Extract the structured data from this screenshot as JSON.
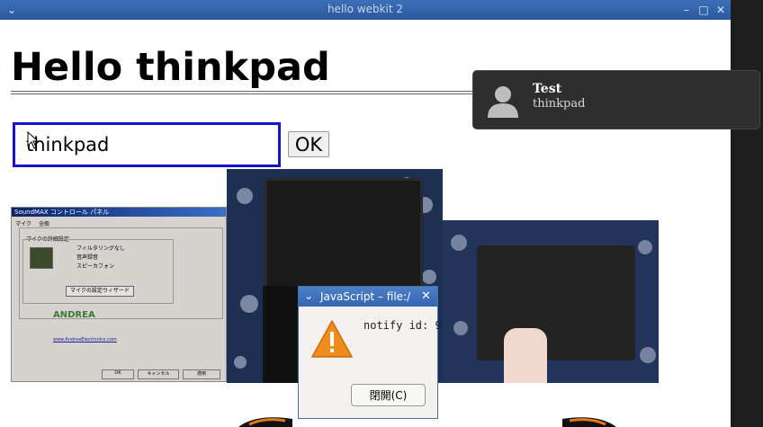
{
  "window": {
    "title": "hello  webkit  2"
  },
  "page": {
    "heading": "Hello thinkpad",
    "input_value": "thinkpad",
    "ok_label": "OK"
  },
  "notification": {
    "title": "Test",
    "body": "thinkpad"
  },
  "dialog": {
    "title": "JavaScript – file:/",
    "message": "notify id: 9",
    "button_label": "閉開(C)"
  },
  "img1": {
    "title": "SoundMAX コントロール パネル",
    "tab1": "マイク",
    "tab2": "全般",
    "group": "マイクの詳細設定",
    "opt1": "フィルタリングなし",
    "opt2": "音声録音",
    "opt3": "スピーカフォン",
    "wizard": "マイクの設定ウィザード",
    "brand": "ANDREA",
    "link": "www.AndreaElectronics.com",
    "btn_ok": "OK",
    "btn_cancel": "キャンセル",
    "btn_apply": "適用"
  },
  "colors": {
    "titlebar": "#2b589e",
    "input_border": "#1414c8",
    "notification_bg": "#2e2e2e",
    "warning": "#f08c1a"
  }
}
